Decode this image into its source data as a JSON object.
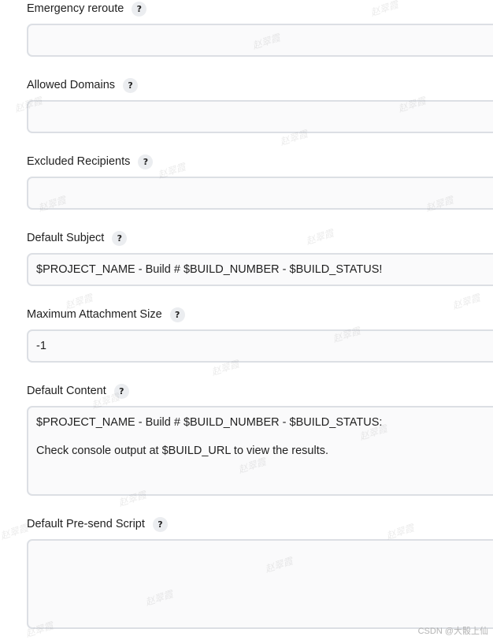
{
  "fields": [
    {
      "label": "Emergency reroute",
      "value": ""
    },
    {
      "label": "Allowed Domains",
      "value": ""
    },
    {
      "label": "Excluded Recipients",
      "value": ""
    },
    {
      "label": "Default Subject",
      "value": "$PROJECT_NAME - Build # $BUILD_NUMBER - $BUILD_STATUS!"
    },
    {
      "label": "Maximum Attachment Size",
      "value": "-1"
    },
    {
      "label": "Default Content",
      "lines": [
        "$PROJECT_NAME - Build # $BUILD_NUMBER - $BUILD_STATUS:",
        "Check console output at $BUILD_URL to view the results."
      ]
    },
    {
      "label": "Default Pre-send Script",
      "value": ""
    }
  ],
  "help_glyph": "?",
  "watermark_text": "赵翠霞",
  "credit_text": "CSDN @大骰上仙"
}
